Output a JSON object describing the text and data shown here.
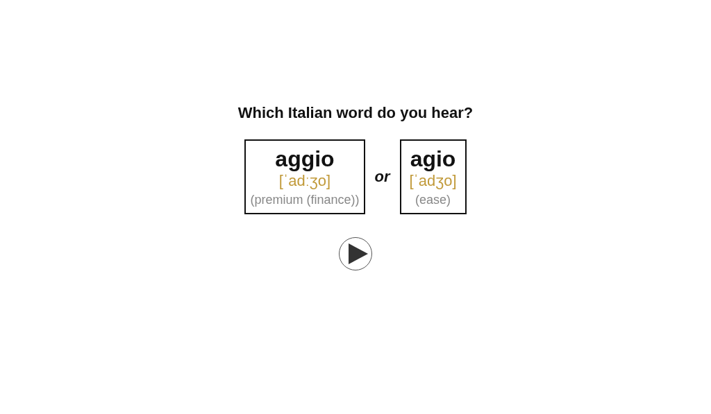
{
  "question": "Which Italian word do you hear?",
  "options": [
    {
      "word": "aggio",
      "ipa": "[ˈadːʒo]",
      "meaning": "(premium (finance))"
    },
    {
      "word": "agio",
      "ipa": "[ˈadʒo]",
      "meaning": "(ease)"
    }
  ],
  "separator": "or"
}
